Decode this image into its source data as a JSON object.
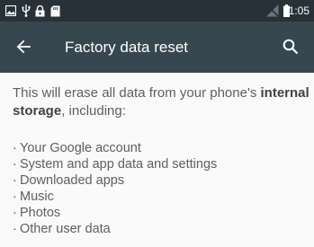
{
  "status_bar": {
    "time": "11:05",
    "icons": [
      "image-icon",
      "usb-icon",
      "lock-icon",
      "sd-card-icon",
      "no-signal-icon",
      "battery-icon"
    ]
  },
  "app_bar": {
    "title": "Factory data reset",
    "back_icon": "arrow-back-icon",
    "search_icon": "search-icon",
    "color": "#37474f"
  },
  "content": {
    "intro_text": "This will erase all data from your phone's ",
    "intro_bold": "internal storage",
    "intro_suffix": ", including:",
    "items": [
      "Your Google account",
      "System and app data and settings",
      "Downloaded apps",
      "Music",
      "Photos",
      "Other user data"
    ]
  }
}
